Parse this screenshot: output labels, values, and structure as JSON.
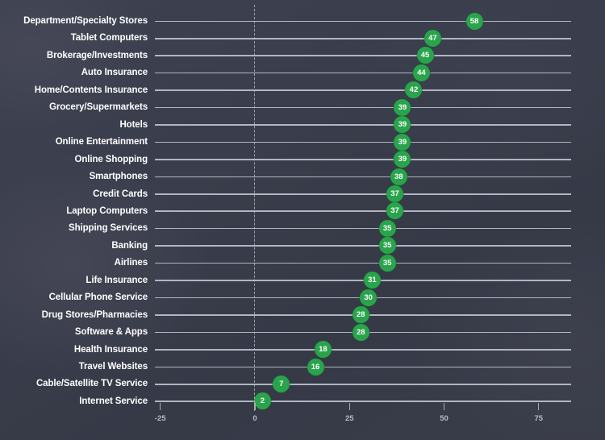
{
  "chart_data": {
    "type": "bar",
    "title": "",
    "subtitle": "",
    "xlabel": "",
    "ylabel": "",
    "xlim": [
      -32,
      84
    ],
    "ylim": null,
    "grid": false,
    "legend": null,
    "orientation": "horizontal",
    "marker_color": "#2aa44c",
    "line_color": "#c3c6d2",
    "background_color": "#393d4b",
    "label_color": "#ffffff",
    "axis_label_color": "#b6bac6",
    "zero_reference": 0,
    "x_ticks": [
      -25,
      0,
      25,
      50,
      75
    ],
    "x_tick_labels": [
      "-25",
      "0",
      "25",
      "50",
      "75"
    ],
    "categories": [
      "Department/Specialty Stores",
      "Tablet Computers",
      "Brokerage/Investments",
      "Auto Insurance",
      "Home/Contents Insurance",
      "Grocery/Supermarkets",
      "Hotels",
      "Online Entertainment",
      "Online Shopping",
      "Smartphones",
      "Credit Cards",
      "Laptop Computers",
      "Shipping Services",
      "Banking",
      "Airlines",
      "Life Insurance",
      "Cellular Phone Service",
      "Drug Stores/Pharmacies",
      "Software & Apps",
      "Health Insurance",
      "Travel Websites",
      "Cable/Satellite TV Service",
      "Internet Service"
    ],
    "values": [
      58,
      47,
      45,
      44,
      42,
      39,
      39,
      39,
      39,
      38,
      37,
      37,
      35,
      35,
      35,
      31,
      30,
      28,
      28,
      18,
      16,
      7,
      2
    ],
    "value_labels": [
      "58",
      "47",
      "45",
      "44",
      "42",
      "39",
      "39",
      "39",
      "39",
      "38",
      "37",
      "37",
      "35",
      "35",
      "35",
      "31",
      "30",
      "28",
      "28",
      "18",
      "16",
      "7",
      "2"
    ]
  }
}
